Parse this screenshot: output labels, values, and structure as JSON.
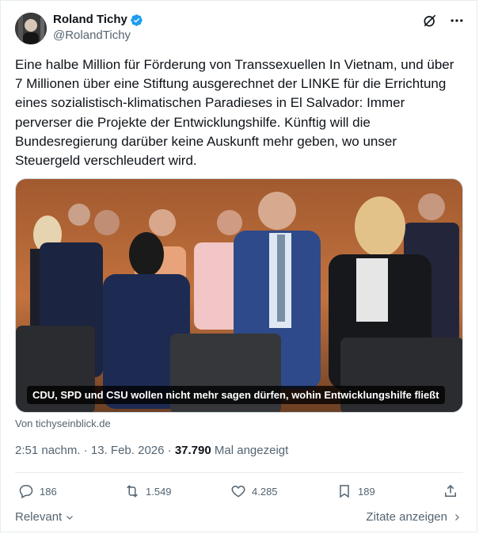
{
  "author": {
    "name": "Roland Tichy",
    "handle": "@RolandTichy"
  },
  "tweet": {
    "text": "Eine halbe Million für Förderung von Transsexuellen In Vietnam, und über\n7 Millionen über eine Stiftung ausgerechnet der LINKE für die Errichtung\neines sozialistisch-klimatischen Paradieses in El Salvador: Immer\nperverser die Projekte der Entwicklungshilfe. Künftig will die\nBundesregierung darüber keine Auskunft mehr geben, wo unser\nSteuergeld verschleudert wird."
  },
  "media": {
    "caption": "CDU, SPD und CSU wollen nicht mehr sagen dürfen, wohin Entwicklungshilfe fließt",
    "source": "Von tichyseinblick.de"
  },
  "meta": {
    "time": "2:51 nachm.",
    "separator": " · ",
    "date": "13. Feb. 2026",
    "views": "37.790",
    "views_label": "Mal angezeigt"
  },
  "actions": {
    "replies": "186",
    "reposts": "1.549",
    "likes": "4.285",
    "bookmarks": "189"
  },
  "footer": {
    "sort_label": "Relevant",
    "quotes_label": "Zitate anzeigen"
  },
  "icons": {
    "verified": "verified-badge-icon",
    "grok": "grok-icon",
    "more": "more-icon",
    "reply": "reply-icon",
    "repost": "repost-icon",
    "like": "heart-icon",
    "bookmark": "bookmark-icon",
    "share": "share-icon"
  },
  "colors": {
    "verified": "#1d9bf0",
    "text": "#0f1419",
    "secondary": "#536471",
    "border": "#e6ecf0"
  }
}
